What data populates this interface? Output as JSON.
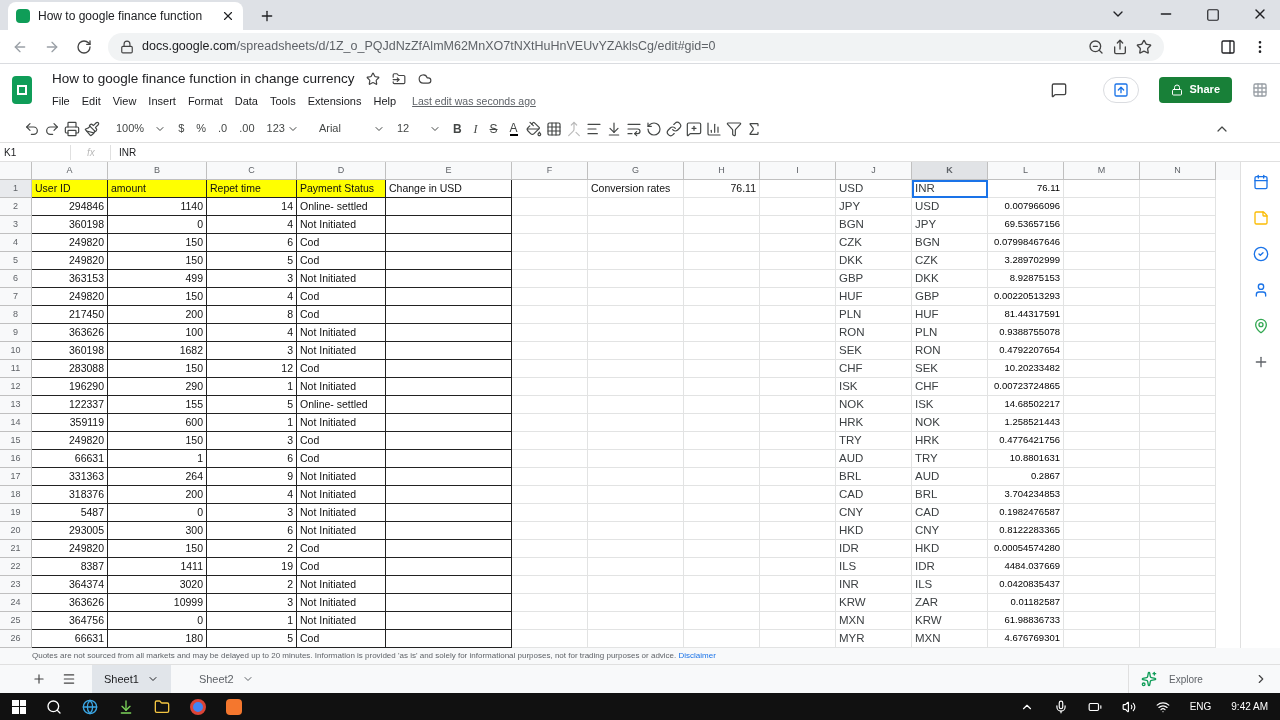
{
  "browser": {
    "tab_title": "How to google finance function",
    "url_host": "docs.google.com",
    "url_path": "/spreadsheets/d/1Z_o_PQJdNzZfAlmM62MnXO7tNXtHuHnVEUvYZAklsCg/edit#gid=0"
  },
  "doc": {
    "title": "How to google finance function in change currency",
    "menus": [
      "File",
      "Edit",
      "View",
      "Insert",
      "Format",
      "Data",
      "Tools",
      "Extensions",
      "Help"
    ],
    "last_edit": "Last edit was seconds ago",
    "share": "Share"
  },
  "toolbar": {
    "zoom": "100%",
    "currency": "$",
    "percent": "%",
    "dec_less": ".0",
    "dec_more": ".00",
    "format": "123",
    "font": "Arial",
    "size": "12",
    "bold": "B",
    "italic": "I",
    "strike": "S",
    "text_color": "A"
  },
  "formula_bar": {
    "cell_ref": "K1",
    "fx": "fx",
    "value": "INR"
  },
  "columns": [
    {
      "label": "A",
      "selected": false
    },
    {
      "label": "B",
      "selected": false
    },
    {
      "label": "C",
      "selected": false
    },
    {
      "label": "D",
      "selected": false
    },
    {
      "label": "E",
      "selected": false
    },
    {
      "label": "F",
      "selected": false
    },
    {
      "label": "G",
      "selected": false
    },
    {
      "label": "H",
      "selected": false
    },
    {
      "label": "I",
      "selected": false
    },
    {
      "label": "J",
      "selected": false
    },
    {
      "label": "K",
      "selected": true
    },
    {
      "label": "L",
      "selected": false
    },
    {
      "label": "M",
      "selected": false
    },
    {
      "label": "N",
      "selected": false
    }
  ],
  "rows": [
    {
      "label": "1",
      "selected": true,
      "cells": {
        "a": "User ID",
        "b": "amount",
        "c": "Repet time",
        "d": "Payment Status",
        "e": "Change in USD",
        "g": "Conversion rates",
        "h": "76.11",
        "j": "USD",
        "k": "INR",
        "l": "76.11"
      }
    },
    {
      "label": "2",
      "selected": false,
      "cells": {
        "a": "294846",
        "b": "1140",
        "c": "14",
        "d": "Online- settled",
        "j": "JPY",
        "k": "USD",
        "l": "0.007966096"
      }
    },
    {
      "label": "3",
      "selected": false,
      "cells": {
        "a": "360198",
        "b": "0",
        "c": "4",
        "d": "Not Initiated",
        "j": "BGN",
        "k": "JPY",
        "l": "69.53657156"
      }
    },
    {
      "label": "4",
      "selected": false,
      "cells": {
        "a": "249820",
        "b": "150",
        "c": "6",
        "d": "Cod",
        "j": "CZK",
        "k": "BGN",
        "l": "0.07998467646"
      }
    },
    {
      "label": "5",
      "selected": false,
      "cells": {
        "a": "249820",
        "b": "150",
        "c": "5",
        "d": "Cod",
        "j": "DKK",
        "k": "CZK",
        "l": "3.289702999"
      }
    },
    {
      "label": "6",
      "selected": false,
      "cells": {
        "a": "363153",
        "b": "499",
        "c": "3",
        "d": "Not Initiated",
        "j": "GBP",
        "k": "DKK",
        "l": "8.92875153"
      }
    },
    {
      "label": "7",
      "selected": false,
      "cells": {
        "a": "249820",
        "b": "150",
        "c": "4",
        "d": "Cod",
        "j": "HUF",
        "k": "GBP",
        "l": "0.00220513293"
      }
    },
    {
      "label": "8",
      "selected": false,
      "cells": {
        "a": "217450",
        "b": "200",
        "c": "8",
        "d": "Cod",
        "j": "PLN",
        "k": "HUF",
        "l": "81.44317591"
      }
    },
    {
      "label": "9",
      "selected": false,
      "cells": {
        "a": "363626",
        "b": "100",
        "c": "4",
        "d": "Not Initiated",
        "j": "RON",
        "k": "PLN",
        "l": "0.9388755078"
      }
    },
    {
      "label": "10",
      "selected": false,
      "cells": {
        "a": "360198",
        "b": "1682",
        "c": "3",
        "d": "Not Initiated",
        "j": "SEK",
        "k": "RON",
        "l": "0.4792207654"
      }
    },
    {
      "label": "11",
      "selected": false,
      "cells": {
        "a": "283088",
        "b": "150",
        "c": "12",
        "d": "Cod",
        "j": "CHF",
        "k": "SEK",
        "l": "10.20233482"
      }
    },
    {
      "label": "12",
      "selected": false,
      "cells": {
        "a": "196290",
        "b": "290",
        "c": "1",
        "d": "Not Initiated",
        "j": "ISK",
        "k": "CHF",
        "l": "0.00723724865"
      }
    },
    {
      "label": "13",
      "selected": false,
      "cells": {
        "a": "122337",
        "b": "155",
        "c": "5",
        "d": "Online- settled",
        "j": "NOK",
        "k": "ISK",
        "l": "14.68502217"
      }
    },
    {
      "label": "14",
      "selected": false,
      "cells": {
        "a": "359119",
        "b": "600",
        "c": "1",
        "d": "Not Initiated",
        "j": "HRK",
        "k": "NOK",
        "l": "1.258521443"
      }
    },
    {
      "label": "15",
      "selected": false,
      "cells": {
        "a": "249820",
        "b": "150",
        "c": "3",
        "d": "Cod",
        "j": "TRY",
        "k": "HRK",
        "l": "0.4776421756"
      }
    },
    {
      "label": "16",
      "selected": false,
      "cells": {
        "a": "66631",
        "b": "1",
        "c": "6",
        "d": "Cod",
        "j": "AUD",
        "k": "TRY",
        "l": "10.8801631"
      }
    },
    {
      "label": "17",
      "selected": false,
      "cells": {
        "a": "331363",
        "b": "264",
        "c": "9",
        "d": "Not Initiated",
        "j": "BRL",
        "k": "AUD",
        "l": "0.2867"
      }
    },
    {
      "label": "18",
      "selected": false,
      "cells": {
        "a": "318376",
        "b": "200",
        "c": "4",
        "d": "Not Initiated",
        "j": "CAD",
        "k": "BRL",
        "l": "3.704234853"
      }
    },
    {
      "label": "19",
      "selected": false,
      "cells": {
        "a": "5487",
        "b": "0",
        "c": "3",
        "d": "Not Initiated",
        "j": "CNY",
        "k": "CAD",
        "l": "0.1982476587"
      }
    },
    {
      "label": "20",
      "selected": false,
      "cells": {
        "a": "293005",
        "b": "300",
        "c": "6",
        "d": "Not Initiated",
        "j": "HKD",
        "k": "CNY",
        "l": "0.8122283365"
      }
    },
    {
      "label": "21",
      "selected": false,
      "cells": {
        "a": "249820",
        "b": "150",
        "c": "2",
        "d": "Cod",
        "j": "IDR",
        "k": "HKD",
        "l": "0.00054574280"
      }
    },
    {
      "label": "22",
      "selected": false,
      "cells": {
        "a": "8387",
        "b": "1411",
        "c": "19",
        "d": "Cod",
        "j": "ILS",
        "k": "IDR",
        "l": "4484.037669"
      }
    },
    {
      "label": "23",
      "selected": false,
      "cells": {
        "a": "364374",
        "b": "3020",
        "c": "2",
        "d": "Not Initiated",
        "j": "INR",
        "k": "ILS",
        "l": "0.0420835437"
      }
    },
    {
      "label": "24",
      "selected": false,
      "cells": {
        "a": "363626",
        "b": "10999",
        "c": "3",
        "d": "Not Initiated",
        "j": "KRW",
        "k": "ZAR",
        "l": "0.01182587"
      }
    },
    {
      "label": "25",
      "selected": false,
      "cells": {
        "a": "364756",
        "b": "0",
        "c": "1",
        "d": "Not Initiated",
        "j": "MXN",
        "k": "KRW",
        "l": "61.98836733"
      }
    },
    {
      "label": "26",
      "selected": false,
      "cells": {
        "a": "66631",
        "b": "180",
        "c": "5",
        "d": "Cod",
        "j": "MYR",
        "k": "MXN",
        "l": "4.676769301"
      }
    }
  ],
  "disclaimer": {
    "text": "Quotes are not sourced from all markets and may be delayed up to 20 minutes. Information is provided 'as is' and solely for informational purposes, not for trading purposes or advice.",
    "link": "Disclaimer"
  },
  "sheets": [
    {
      "label": "Sheet1",
      "selected": true
    },
    {
      "label": "Sheet2",
      "selected": false
    }
  ],
  "explore": "Explore",
  "taskbar": {
    "language": "ENG",
    "time": "9:42 AM"
  }
}
